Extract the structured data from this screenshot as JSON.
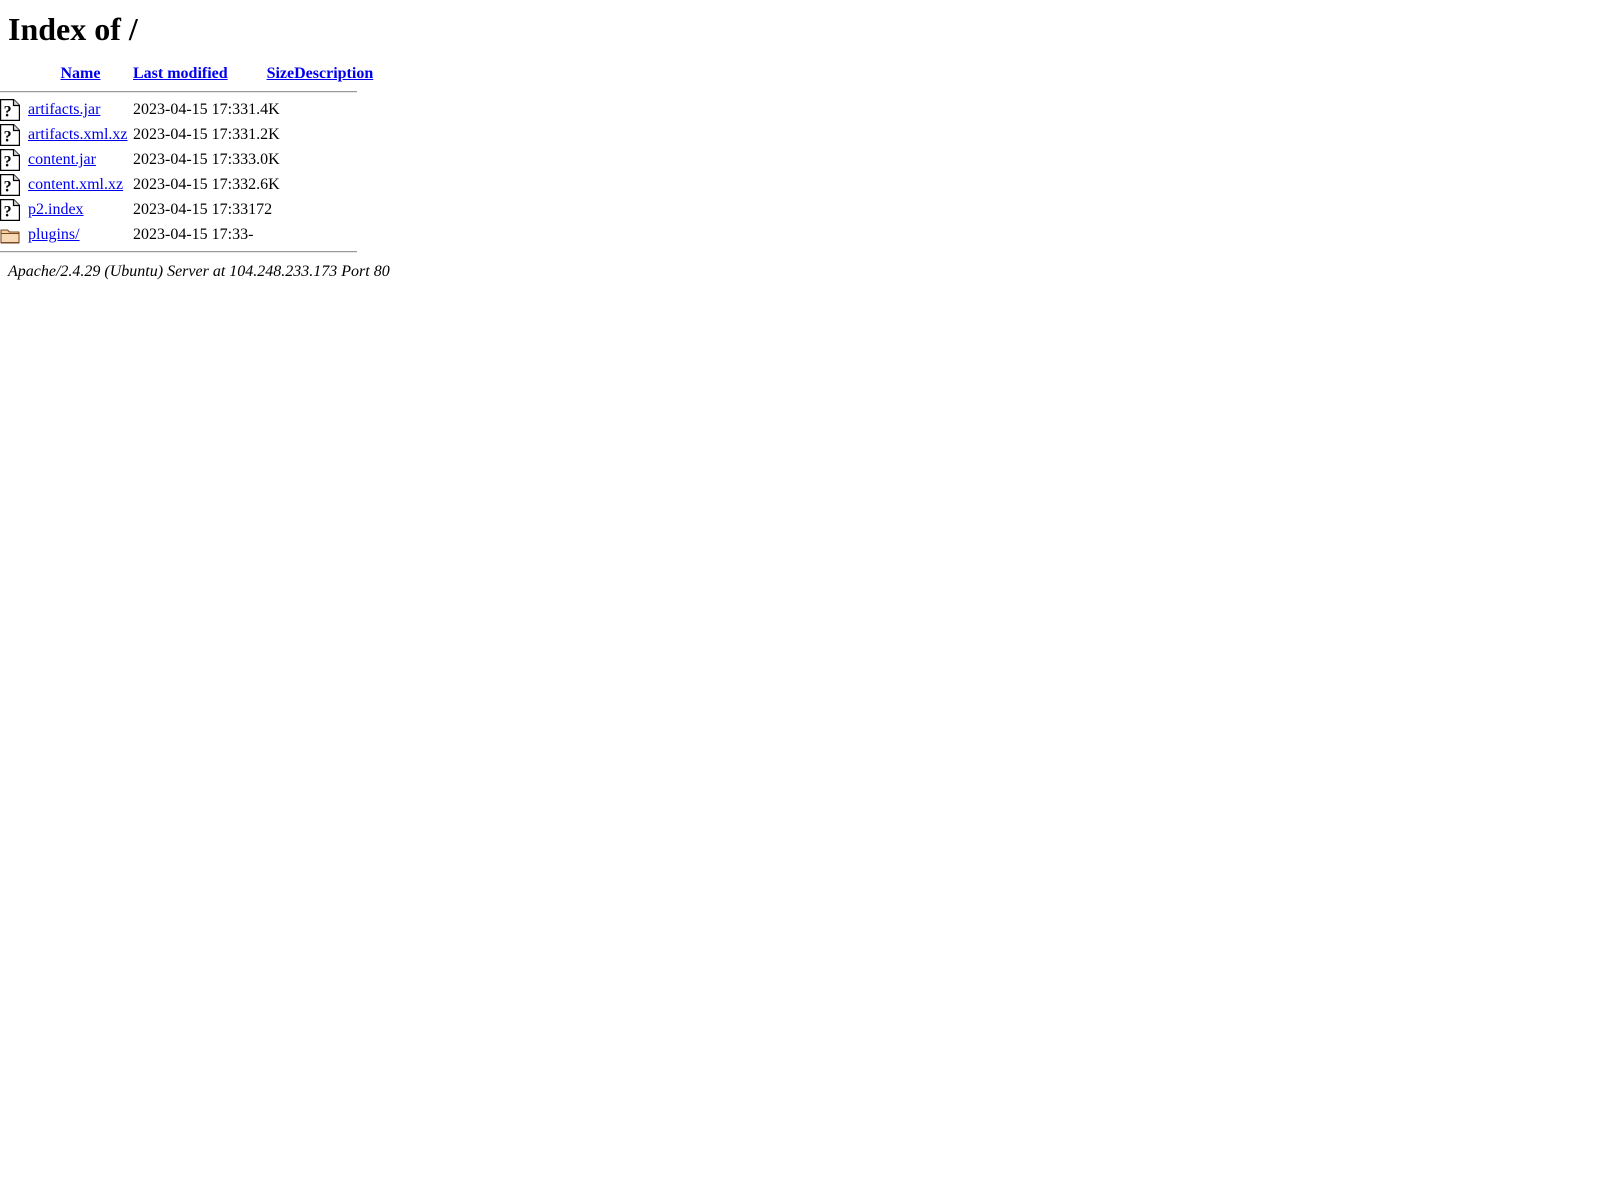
{
  "page": {
    "title": "Index of /",
    "background": "#ffffff",
    "link_color": "#0000ee",
    "rule_color": "#9a9a9a"
  },
  "table": {
    "columns": [
      {
        "key": "icon",
        "label": "",
        "icon": "blank-icon"
      },
      {
        "key": "name",
        "label": "Name"
      },
      {
        "key": "date",
        "label": "Last modified"
      },
      {
        "key": "size",
        "label": "Size"
      },
      {
        "key": "desc",
        "label": "Description"
      }
    ],
    "rows": [
      {
        "icon": "unknown-file-icon",
        "icon_alt": "[   ]",
        "name": "artifacts.jar",
        "date": "2023-04-15 17:33",
        "size": "1.4K",
        "desc": ""
      },
      {
        "icon": "unknown-file-icon",
        "icon_alt": "[   ]",
        "name": "artifacts.xml.xz",
        "date": "2023-04-15 17:33",
        "size": "1.2K",
        "desc": ""
      },
      {
        "icon": "unknown-file-icon",
        "icon_alt": "[   ]",
        "name": "content.jar",
        "date": "2023-04-15 17:33",
        "size": "3.0K",
        "desc": ""
      },
      {
        "icon": "unknown-file-icon",
        "icon_alt": "[   ]",
        "name": "content.xml.xz",
        "date": "2023-04-15 17:33",
        "size": "2.6K",
        "desc": ""
      },
      {
        "icon": "unknown-file-icon",
        "icon_alt": "[   ]",
        "name": "p2.index",
        "date": "2023-04-15 17:33",
        "size": "172",
        "desc": ""
      },
      {
        "icon": "folder-icon",
        "icon_alt": "[DIR]",
        "name": "plugins/",
        "date": "2023-04-15 17:33",
        "size": "-",
        "desc": ""
      }
    ]
  },
  "footer": {
    "signature": "Apache/2.4.29 (Ubuntu) Server at 104.248.233.173 Port 80"
  }
}
